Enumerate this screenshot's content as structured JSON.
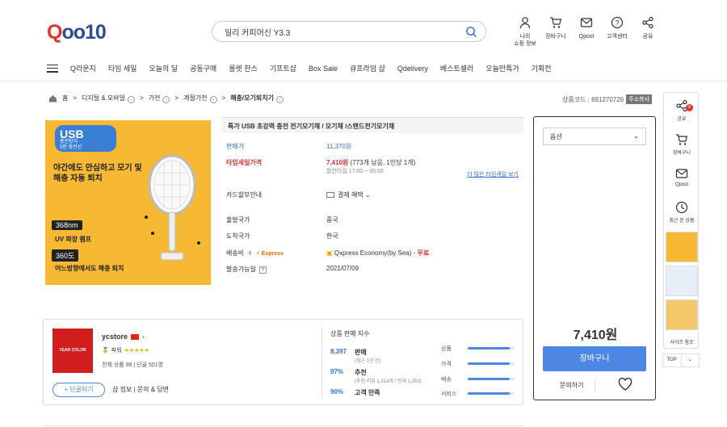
{
  "header": {
    "logo_q": "Q",
    "logo_rest": "oo10",
    "search_value": "일리 커피머신 Y3.3",
    "icons": [
      {
        "label": "나의\n쇼핑 정보",
        "icon": "user-icon"
      },
      {
        "label": "장바구니",
        "icon": "cart-icon"
      },
      {
        "label": "Qpost",
        "icon": "mail-icon"
      },
      {
        "label": "고객센터",
        "icon": "help-icon"
      },
      {
        "label": "공유",
        "icon": "share-icon"
      }
    ]
  },
  "nav": [
    "Q라운지",
    "타임 세일",
    "오늘의 딜",
    "공동구매",
    "룰렛 찬스",
    "기프트샵",
    "Box Sale",
    "큐프라임 샵",
    "Qdelivery",
    "베스트셀러",
    "오늘만특가",
    "기획전"
  ],
  "breadcrumb": {
    "home": "홈",
    "items": [
      "디지털 & 모바일",
      "가전",
      "계절가전",
      "해충/모기퇴치기"
    ]
  },
  "product_code": {
    "label": "상품코드 : 691270726",
    "copy": "주소복사"
  },
  "image": {
    "badge_title": "USB",
    "badge_sub1": "충전방식",
    "badge_sub2": "5핀 충전선",
    "headline": "야간에도 안심하고 모기 및 해충 자동 퇴치",
    "chip1": "368nm",
    "sub1": "UV 파장 램프",
    "chip2": "360도",
    "sub2": "어느방향에서도 해충 퇴치"
  },
  "product": {
    "title": "특가 USB 초강력 충전 전기모기채 / 모기채 /스탠드전기모기채",
    "list_price_label": "판매가",
    "list_price": "11,370원",
    "sale_label": "타임세일가격",
    "sale_price": "7,410원",
    "sale_note": "(773개 남음, 1인당 1개)",
    "sale_time": "할인타임 17:00 ~ 00:00",
    "more_link": "더 많은 타임세일 보기",
    "card_label": "카드할부안내",
    "card_value": "결제 혜택",
    "origin_label": "출발국가",
    "origin_value": "중국",
    "dest_label": "도착국가",
    "dest_value": "한국",
    "ship_label": "배송비",
    "ship_express": "Express",
    "ship_value": "Qxpress Economy(by Sea) -",
    "ship_free": "무료",
    "avail_label": "발송가능일",
    "avail_help": "?",
    "avail_value": "2021/07/09"
  },
  "buy": {
    "option_placeholder": "옵션",
    "price": "7,410원",
    "cart": "장바구니",
    "inquiry": "문의하기"
  },
  "seller": {
    "logo_text": "YEAR COLOR",
    "name": "ycstore",
    "grade": "파워",
    "stars": "★★★★★",
    "stats": "전체 상품 98   |   단골 551명",
    "follow": "+ 단골되기",
    "links": "샵 정보   |   문의 & 답변",
    "index_title": "상품 판매 지수",
    "metrics": [
      {
        "num": "8,397",
        "label": "판매",
        "sub": "(최근 1년 간)"
      },
      {
        "num": "97%",
        "label": "추천",
        "sub": "(추천 리뷰 1,314개 / 전체 1,353)"
      },
      {
        "num": "90%",
        "label": "고객 만족",
        "sub": ""
      }
    ],
    "bars": [
      {
        "label": "상품",
        "value": 0.9
      },
      {
        "label": "가격",
        "value": 0.9
      },
      {
        "label": "배송",
        "value": 0.9
      },
      {
        "label": "서비스",
        "value": 0.9
      }
    ]
  },
  "sidebar": {
    "share": "공유",
    "share_badge": "8",
    "cart": "장바구니",
    "qpost": "Qpost",
    "recent": "최근 본 상품",
    "size": "사이즈 참조",
    "top": "TOP"
  },
  "colors": {
    "accent": "#4e86e4",
    "brand_red": "#e8322b",
    "brand_blue": "#2c4b9b"
  }
}
